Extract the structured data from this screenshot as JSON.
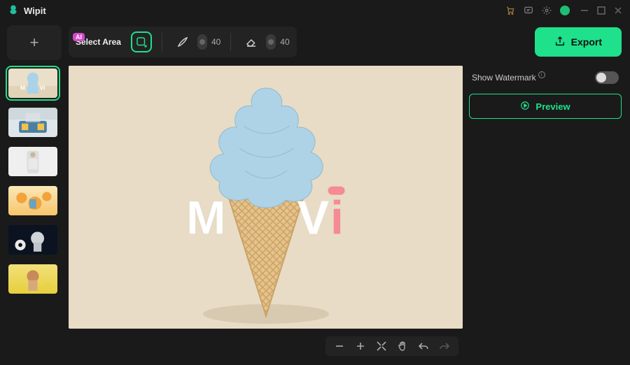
{
  "app": {
    "name": "Wipit"
  },
  "titlebar": {
    "icons": [
      "cart-icon",
      "chat-icon",
      "gear-icon",
      "avatar"
    ],
    "window": [
      "minimize",
      "maximize",
      "close"
    ]
  },
  "toolbar": {
    "ai_badge": "AI",
    "select_area_label": "Select Area",
    "brush_size": "40",
    "eraser_size": "40",
    "export_label": "Export"
  },
  "sidebar": {
    "add_tooltip": "+",
    "thumb_count": 6
  },
  "right": {
    "show_watermark_label": "Show Watermark",
    "preview_label": "Preview",
    "watermark_on": false
  },
  "canvas": {
    "watermark_text_left": "M",
    "watermark_text_mid": "V",
    "watermark_text_right": "i",
    "background": "#e8dcc6"
  },
  "canvas_tools": {
    "items": [
      "zoom-out",
      "zoom-in",
      "fit",
      "pan",
      "undo",
      "redo"
    ]
  }
}
